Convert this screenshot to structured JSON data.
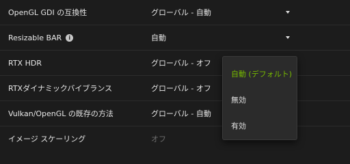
{
  "settings": [
    {
      "label": "OpenGL GDI の互換性",
      "value": "グローバル - 自動",
      "has_dropdown": true
    },
    {
      "label": "Resizable BAR",
      "value": "自動",
      "has_dropdown": true,
      "info_icon": "i"
    },
    {
      "label": "RTX HDR",
      "value": "グローバル - オフ",
      "has_dropdown": false
    },
    {
      "label": "RTXダイナミックバイブランス",
      "value": "グローバル - オフ",
      "has_dropdown": false
    },
    {
      "label": "Vulkan/OpenGL の既存の方法",
      "value": "グローバル - 自動",
      "has_dropdown": false
    },
    {
      "label": "イメージ スケーリング",
      "value": "オフ",
      "has_dropdown": false,
      "disabled": true
    }
  ],
  "dropdown": {
    "options": [
      "自動 (デフォルト)",
      "無効",
      "有効"
    ],
    "selected_index": 0
  },
  "colors": {
    "background": "#1c1c1c",
    "accent": "#76b900",
    "menu_background": "#2b2b2b"
  }
}
